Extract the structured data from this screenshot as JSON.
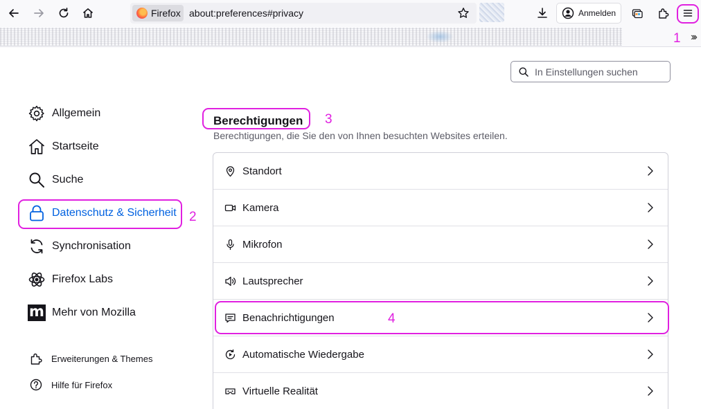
{
  "toolbar": {
    "identity_label": "Firefox",
    "url": "about:preferences#privacy",
    "signin_label": "Anmelden",
    "icons": [
      "back-icon",
      "forward-icon",
      "reload-icon",
      "home-icon",
      "star-icon",
      "download-icon",
      "account-icon",
      "tab-icon",
      "extensions-icon",
      "menu-icon",
      "chevron-double-right-icon"
    ]
  },
  "annotations": {
    "n1": "1",
    "n2": "2",
    "n3": "3",
    "n4": "4",
    "color": "#e020e0"
  },
  "search": {
    "placeholder": "In Einstellungen suchen"
  },
  "sidebar": {
    "items": [
      {
        "label": "Allgemein",
        "icon": "gear-icon"
      },
      {
        "label": "Startseite",
        "icon": "home-icon"
      },
      {
        "label": "Suche",
        "icon": "search-icon"
      },
      {
        "label": "Datenschutz & Sicherheit",
        "icon": "lock-icon",
        "active": true
      },
      {
        "label": "Synchronisation",
        "icon": "sync-icon"
      },
      {
        "label": "Firefox Labs",
        "icon": "labs-icon"
      },
      {
        "label": "Mehr von Mozilla",
        "icon": "mozilla-icon"
      }
    ],
    "footer": [
      {
        "label": "Erweiterungen & Themes",
        "icon": "puzzle-icon"
      },
      {
        "label": "Hilfe für Firefox",
        "icon": "help-icon"
      }
    ],
    "active_color": "#0061e0"
  },
  "main": {
    "title": "Berechtigungen",
    "description": "Berechtigungen, die Sie den von Ihnen besuchten Websites erteilen.",
    "permissions": [
      {
        "label": "Standort",
        "icon": "location-icon"
      },
      {
        "label": "Kamera",
        "icon": "camera-icon"
      },
      {
        "label": "Mikrofon",
        "icon": "microphone-icon"
      },
      {
        "label": "Lautsprecher",
        "icon": "speaker-icon"
      },
      {
        "label": "Benachrichtigungen",
        "icon": "notification-icon"
      },
      {
        "label": "Automatische Wiedergabe",
        "icon": "autoplay-icon"
      },
      {
        "label": "Virtuelle Realität",
        "icon": "vr-icon"
      }
    ]
  }
}
